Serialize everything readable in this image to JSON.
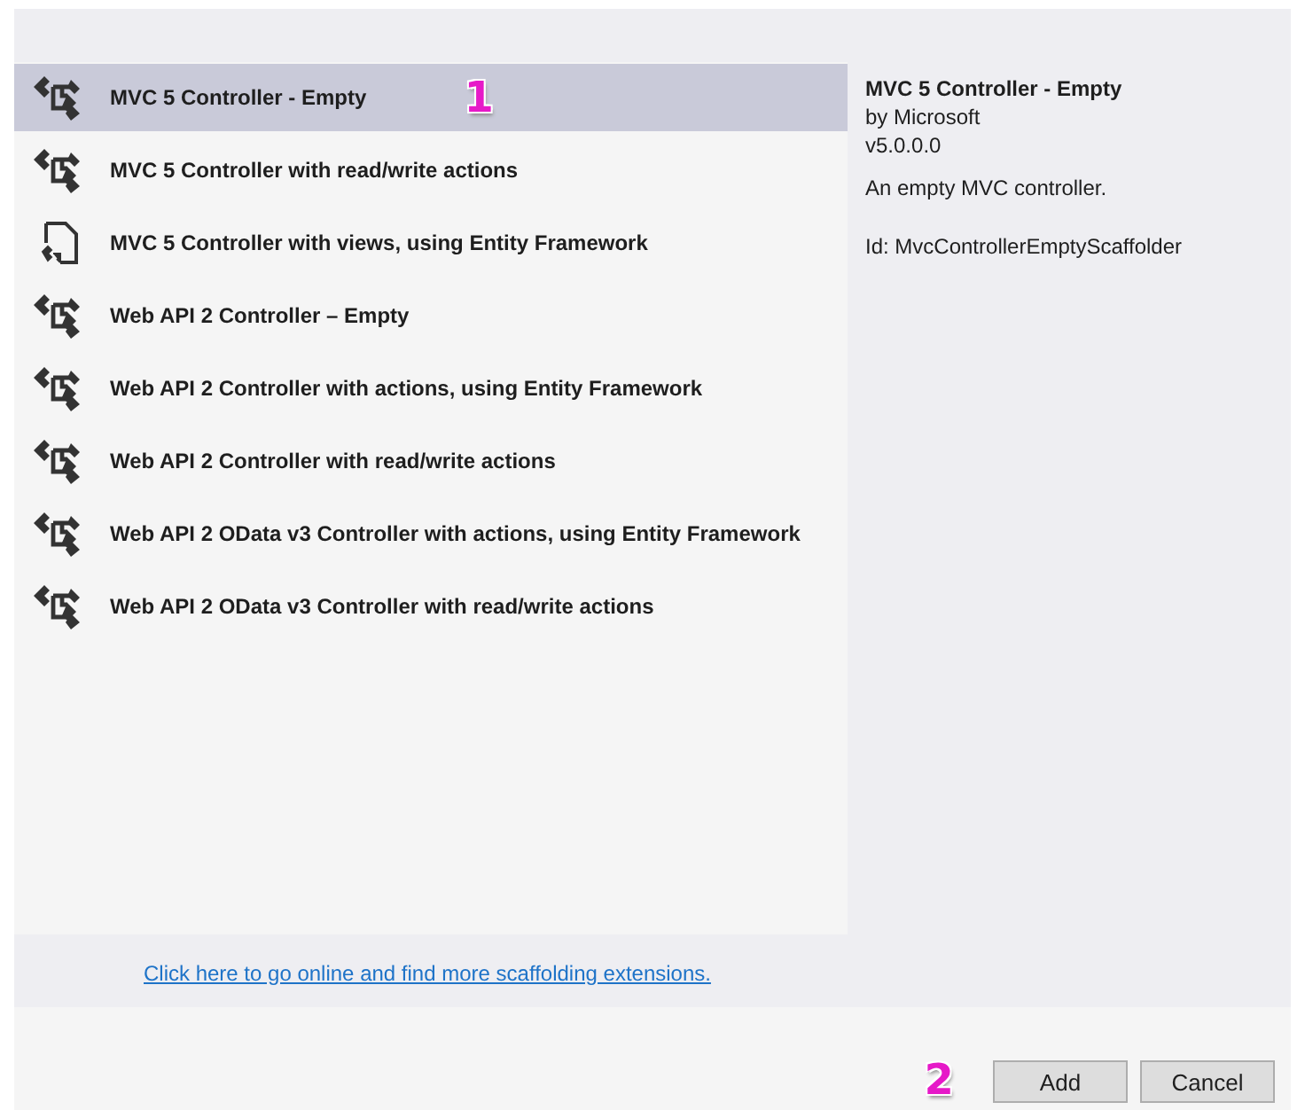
{
  "items": [
    {
      "kind": "controller",
      "label": "MVC 5 Controller - Empty",
      "selected": true,
      "callout": "1"
    },
    {
      "kind": "controller",
      "label": "MVC 5 Controller with read/write actions",
      "selected": false
    },
    {
      "kind": "views",
      "label": "MVC 5 Controller with views, using Entity Framework",
      "selected": false
    },
    {
      "kind": "controller",
      "label": "Web API 2 Controller – Empty",
      "selected": false
    },
    {
      "kind": "controller",
      "label": "Web API 2 Controller with actions, using Entity Framework",
      "selected": false
    },
    {
      "kind": "controller",
      "label": "Web API 2 Controller with read/write actions",
      "selected": false
    },
    {
      "kind": "controller",
      "label": "Web API 2 OData v3 Controller with actions, using Entity Framework",
      "selected": false
    },
    {
      "kind": "controller",
      "label": "Web API 2 OData v3 Controller with read/write actions",
      "selected": false
    }
  ],
  "details": {
    "title": "MVC 5 Controller - Empty",
    "author": "by Microsoft",
    "version": "v5.0.0.0",
    "description": "An empty MVC controller.",
    "id": "Id: MvcControllerEmptyScaffolder"
  },
  "online_link": "Click here to go online and find more scaffolding extensions.",
  "footer": {
    "callout": "2",
    "buttons": [
      "Add",
      "Cancel"
    ]
  }
}
